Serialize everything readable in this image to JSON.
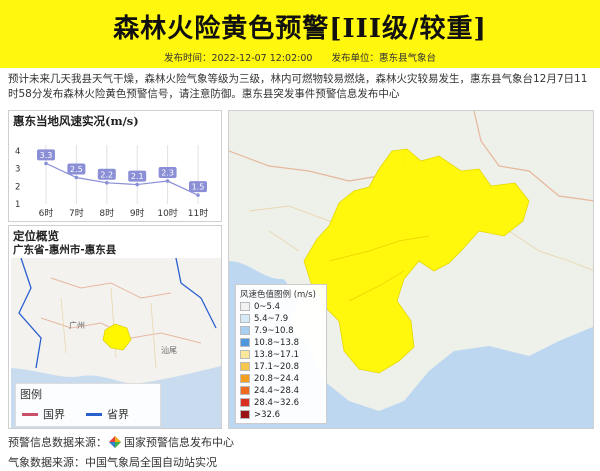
{
  "header": {
    "title": "森林火险黄色预警[III级/较重]",
    "publish_time_label": "发布时间：2022-12-07 12:02:00",
    "publisher_label": "发布单位：惠东县气象台",
    "color": "#fff70d"
  },
  "description": "预计未来几天我县天气干燥，森林火险气象等级为三级，林内可燃物较易燃烧，森林火灾较易发生，惠东县气象台12月7日11时58分发布森林火险黄色预警信号，请注意防御。惠东县突发事件预警信息发布中心",
  "wind_panel": {
    "title": "惠东当地风速实况(m/s)",
    "chart_data": {
      "type": "line",
      "categories": [
        "6时",
        "7时",
        "8时",
        "9时",
        "10时",
        "11时"
      ],
      "values": [
        3.3,
        2.5,
        2.2,
        2.1,
        2.3,
        1.5
      ],
      "y_ticks": [
        "1",
        "2",
        "3",
        "4"
      ],
      "ylim": [
        1,
        4
      ],
      "grid": true,
      "series_color": "#8a8fd6"
    }
  },
  "location_panel": {
    "title": "定位概览",
    "subtitle": "广东省-惠州市-惠东县",
    "map_labels": [
      "广州",
      "汕尾"
    ],
    "legend": {
      "title": "图例",
      "items": [
        {
          "label": "国界",
          "color": "#c8506a"
        },
        {
          "label": "省界",
          "color": "#2a5fcf"
        }
      ]
    }
  },
  "main_map": {
    "highlight_color": "#fff700",
    "legend_title": "风速色值图例 (m/s)",
    "legend": [
      {
        "label": "0~5.4",
        "color": "#f2f2f2"
      },
      {
        "label": "5.4~7.9",
        "color": "#d6e9f7"
      },
      {
        "label": "7.9~10.8",
        "color": "#a9cff0"
      },
      {
        "label": "10.8~13.8",
        "color": "#4f97dc"
      },
      {
        "label": "13.8~17.1",
        "color": "#f9e79a"
      },
      {
        "label": "17.1~20.8",
        "color": "#f6c74e"
      },
      {
        "label": "20.8~24.4",
        "color": "#f3a021"
      },
      {
        "label": "24.4~28.4",
        "color": "#ee6a1e"
      },
      {
        "label": "28.4~32.6",
        "color": "#d9301f"
      },
      {
        "label": ">32.6",
        "color": "#9b1414"
      }
    ]
  },
  "footer": {
    "warning_source": "预警信息数据来源：",
    "warning_source_name": "国家预警信息发布中心",
    "weather_source": "气象数据来源：中国气象局全国自动站实况"
  }
}
